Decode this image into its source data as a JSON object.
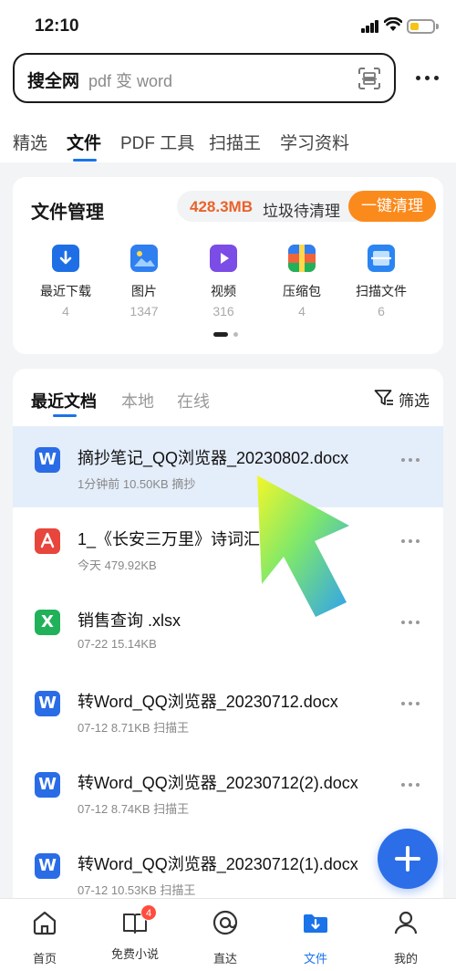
{
  "status": {
    "time": "12:10",
    "battery_color": "#f5c417"
  },
  "search": {
    "brand": "搜全网",
    "placeholder": "pdf 变 word"
  },
  "tabs": [
    {
      "label": "精选",
      "active": false
    },
    {
      "label": "文件",
      "active": true
    },
    {
      "label": "PDF 工具",
      "active": false
    },
    {
      "label": "扫描王",
      "active": false
    },
    {
      "label": "学习资料",
      "active": false
    }
  ],
  "file_manager": {
    "title": "文件管理",
    "junk_size": "428.3MB",
    "junk_label": "垃圾待清理",
    "clean_button": "一键清理",
    "categories": [
      {
        "label": "最近下载",
        "count": "4",
        "icon": "download-icon",
        "color": "#1e6fe6"
      },
      {
        "label": "图片",
        "count": "1347",
        "icon": "image-icon",
        "color": "#2f7ff0"
      },
      {
        "label": "视频",
        "count": "316",
        "icon": "video-icon",
        "color": "#7b4ce6"
      },
      {
        "label": "压缩包",
        "count": "4",
        "icon": "archive-icon",
        "color": "#f0643c"
      },
      {
        "label": "扫描文件",
        "count": "6",
        "icon": "scan-file-icon",
        "color": "#2a85f2"
      }
    ]
  },
  "recent": {
    "tabs": [
      {
        "label": "最近文档",
        "active": true
      },
      {
        "label": "本地",
        "active": false
      },
      {
        "label": "在线",
        "active": false
      }
    ],
    "filter_label": "筛选",
    "files": [
      {
        "name": "摘抄笔记_QQ浏览器_20230802.docx",
        "meta": "1分钟前  10.50KB  摘抄",
        "type": "W",
        "color": "#2a6ce6",
        "selected": true
      },
      {
        "name": "1_《长安三万里》诗词汇",
        "meta": "今天  479.92KB",
        "type": "pdf",
        "color": "#e8453c",
        "selected": false
      },
      {
        "name": "销售查询 .xlsx",
        "meta": "07-22  15.14KB",
        "type": "X",
        "color": "#21b15a",
        "selected": false
      },
      {
        "name": "转Word_QQ浏览器_20230712.docx",
        "meta": "07-12  8.71KB  扫描王",
        "type": "W",
        "color": "#2a6ce6",
        "selected": false
      },
      {
        "name": "转Word_QQ浏览器_20230712(2).docx",
        "meta": "07-12  8.74KB  扫描王",
        "type": "W",
        "color": "#2a6ce6",
        "selected": false
      },
      {
        "name": "转Word_QQ浏览器_20230712(1).docx",
        "meta": "07-12  10.53KB  扫描王",
        "type": "W",
        "color": "#2a6ce6",
        "selected": false
      }
    ]
  },
  "bottom_nav": [
    {
      "label": "首页",
      "icon": "home-icon",
      "active": false
    },
    {
      "label": "免费小说",
      "icon": "book-icon",
      "active": false,
      "badge": "4"
    },
    {
      "label": "直达",
      "icon": "direct-icon",
      "active": false
    },
    {
      "label": "文件",
      "icon": "folder-icon",
      "active": true
    },
    {
      "label": "我的",
      "icon": "profile-icon",
      "active": false
    }
  ],
  "accent_color": "#1a73e8"
}
